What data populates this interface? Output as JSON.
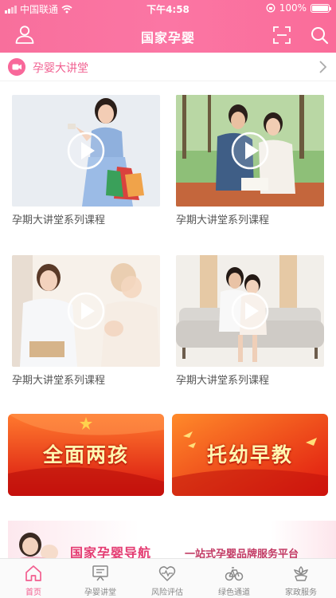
{
  "status_bar": {
    "carrier": "中国联通",
    "time": "下午4:58",
    "battery": "100%"
  },
  "navbar": {
    "title": "国家孕婴",
    "user_icon": "user-icon",
    "scan_icon": "scan-icon",
    "search_icon": "search-icon"
  },
  "section": {
    "title": "孕婴大讲堂",
    "icon": "video-camera-icon",
    "more_icon": "chevron-right-icon"
  },
  "courses": [
    {
      "label": "孕期大讲堂系列课程"
    },
    {
      "label": "孕期大讲堂系列课程"
    },
    {
      "label": "孕期大讲堂系列课程"
    },
    {
      "label": "孕期大讲堂系列课程"
    }
  ],
  "banners": [
    {
      "text": "全面两孩"
    },
    {
      "text": "托幼早教"
    }
  ],
  "ad": {
    "title": "国家孕婴导航",
    "subtitle": "一站式孕婴品牌服务平台"
  },
  "tabs": [
    {
      "label": "首页",
      "icon": "home-icon",
      "active": true
    },
    {
      "label": "孕婴讲堂",
      "icon": "lecture-icon",
      "active": false
    },
    {
      "label": "风险评估",
      "icon": "heart-pulse-icon",
      "active": false
    },
    {
      "label": "绿色通道",
      "icon": "bicycle-icon",
      "active": false
    },
    {
      "label": "家政服务",
      "icon": "flower-icon",
      "active": false
    }
  ],
  "colors": {
    "brand": "#f86f9c",
    "active_tab": "#f25e8f"
  }
}
